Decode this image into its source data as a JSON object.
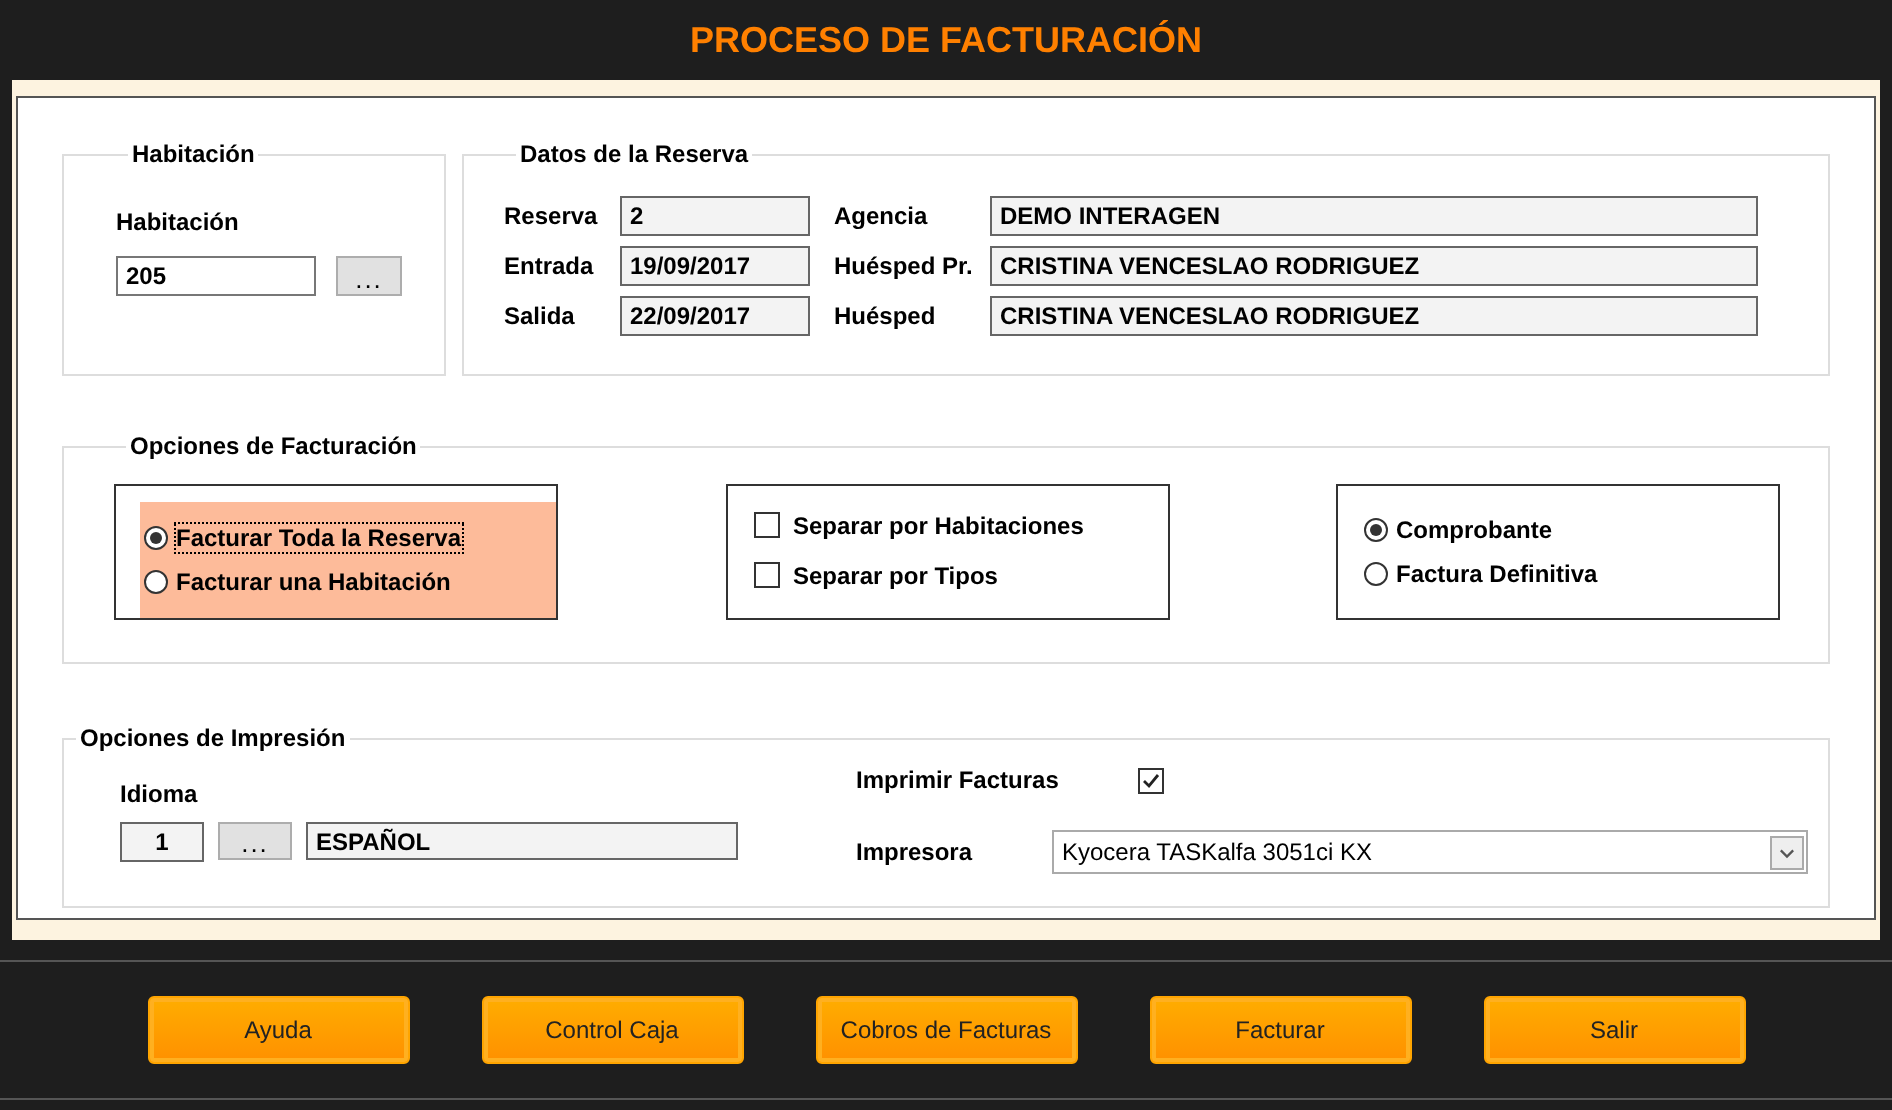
{
  "title": "PROCESO DE FACTURACIÓN",
  "habitacion": {
    "legend": "Habitación",
    "label": "Habitación",
    "value": "205",
    "lookup": "..."
  },
  "reserva": {
    "legend": "Datos de la Reserva",
    "left": [
      {
        "label": "Reserva",
        "value": "2"
      },
      {
        "label": "Entrada",
        "value": "19/09/2017"
      },
      {
        "label": "Salida",
        "value": "22/09/2017"
      }
    ],
    "right": [
      {
        "label": "Agencia",
        "value": "DEMO INTERAGEN"
      },
      {
        "label": "Huésped Pr.",
        "value": "CRISTINA VENCESLAO RODRIGUEZ"
      },
      {
        "label": "Huésped",
        "value": "CRISTINA VENCESLAO RODRIGUEZ"
      }
    ]
  },
  "facturacion": {
    "legend": "Opciones de Facturación",
    "scope": {
      "highlighted": true,
      "options": [
        {
          "label": "Facturar Toda la Reserva",
          "selected": true,
          "focused": true
        },
        {
          "label": "Facturar una Habitación",
          "selected": false,
          "focused": false
        }
      ]
    },
    "separation": [
      {
        "label": "Separar por Habitaciones",
        "checked": false
      },
      {
        "label": "Separar por Tipos",
        "checked": false
      }
    ],
    "type": [
      {
        "label": "Comprobante",
        "selected": true
      },
      {
        "label": "Factura Definitiva",
        "selected": false
      }
    ]
  },
  "impresion": {
    "legend": "Opciones de Impresión",
    "idioma": {
      "label": "Idioma",
      "code": "1",
      "lookup": "...",
      "name": "ESPAÑOL"
    },
    "print": {
      "label": "Imprimir Facturas",
      "checked": true
    },
    "printer": {
      "label": "Impresora",
      "value": "Kyocera TASKalfa 3051ci KX"
    }
  },
  "buttons": [
    "Ayuda",
    "Control Caja",
    "Cobros de Facturas",
    "Facturar",
    "Salir"
  ]
}
